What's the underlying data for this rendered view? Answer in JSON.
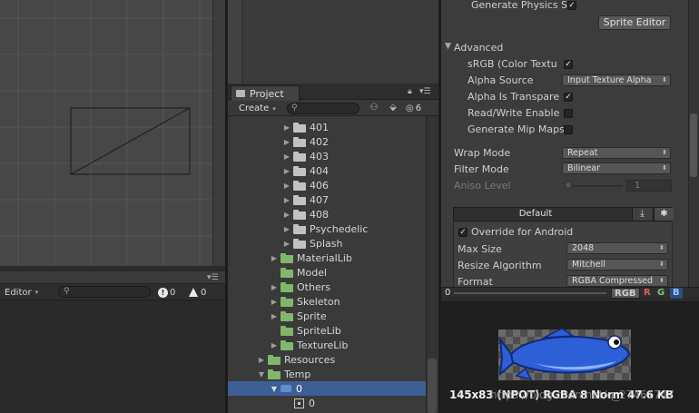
{
  "console": {
    "editor_label": "Editor",
    "info_count": "0",
    "warn_count": "0"
  },
  "project": {
    "tab_label": "Project",
    "create_label": "Create",
    "hidden_count": "6",
    "tree": [
      {
        "label": "401",
        "kind": "grey"
      },
      {
        "label": "402",
        "kind": "grey"
      },
      {
        "label": "403",
        "kind": "grey"
      },
      {
        "label": "404",
        "kind": "grey"
      },
      {
        "label": "406",
        "kind": "grey"
      },
      {
        "label": "407",
        "kind": "grey"
      },
      {
        "label": "408",
        "kind": "grey"
      },
      {
        "label": "Psychedelic",
        "kind": "grey"
      },
      {
        "label": "Splash",
        "kind": "grey"
      },
      {
        "label": "MaterialLib",
        "kind": "green"
      },
      {
        "label": "Model",
        "kind": "green"
      },
      {
        "label": "Others",
        "kind": "green"
      },
      {
        "label": "Skeleton",
        "kind": "green"
      },
      {
        "label": "Sprite",
        "kind": "green"
      },
      {
        "label": "SpriteLib",
        "kind": "green"
      },
      {
        "label": "TextureLib",
        "kind": "green"
      },
      {
        "label": "Resources",
        "kind": "green"
      },
      {
        "label": "Temp",
        "kind": "green"
      },
      {
        "label": "0",
        "kind": "sprite"
      },
      {
        "label": "0",
        "kind": "texture"
      }
    ]
  },
  "inspector": {
    "generate_physics": "Generate Physics S",
    "sprite_editor": "Sprite Editor",
    "advanced": "Advanced",
    "srgb": "sRGB (Color Textu",
    "alpha_source": "Alpha Source",
    "alpha_source_value": "Input Texture Alpha",
    "alpha_transparency": "Alpha Is Transpare",
    "read_write": "Read/Write Enable",
    "gen_mipmaps": "Generate Mip Maps",
    "wrap_mode": "Wrap Mode",
    "wrap_mode_value": "Repeat",
    "filter_mode": "Filter Mode",
    "filter_mode_value": "Bilinear",
    "aniso_level": "Aniso Level",
    "aniso_value": "1",
    "platform_default": "Default",
    "override_android": "Override for Android",
    "max_size": "Max Size",
    "max_size_value": "2048",
    "resize_algorithm": "Resize Algorithm",
    "resize_value": "Mitchell",
    "format": "Format",
    "format_value": "RGBA Compressed"
  },
  "preview": {
    "mip_value": "0",
    "channel_rgb": "RGB",
    "channel_r": "R",
    "channel_g": "G",
    "channel_b": "B",
    "info": "145x83 (NPOT)  RGBA 8 Norm  47.6 KB",
    "watermark": "https://blog.csdn.net/q_27461747"
  }
}
